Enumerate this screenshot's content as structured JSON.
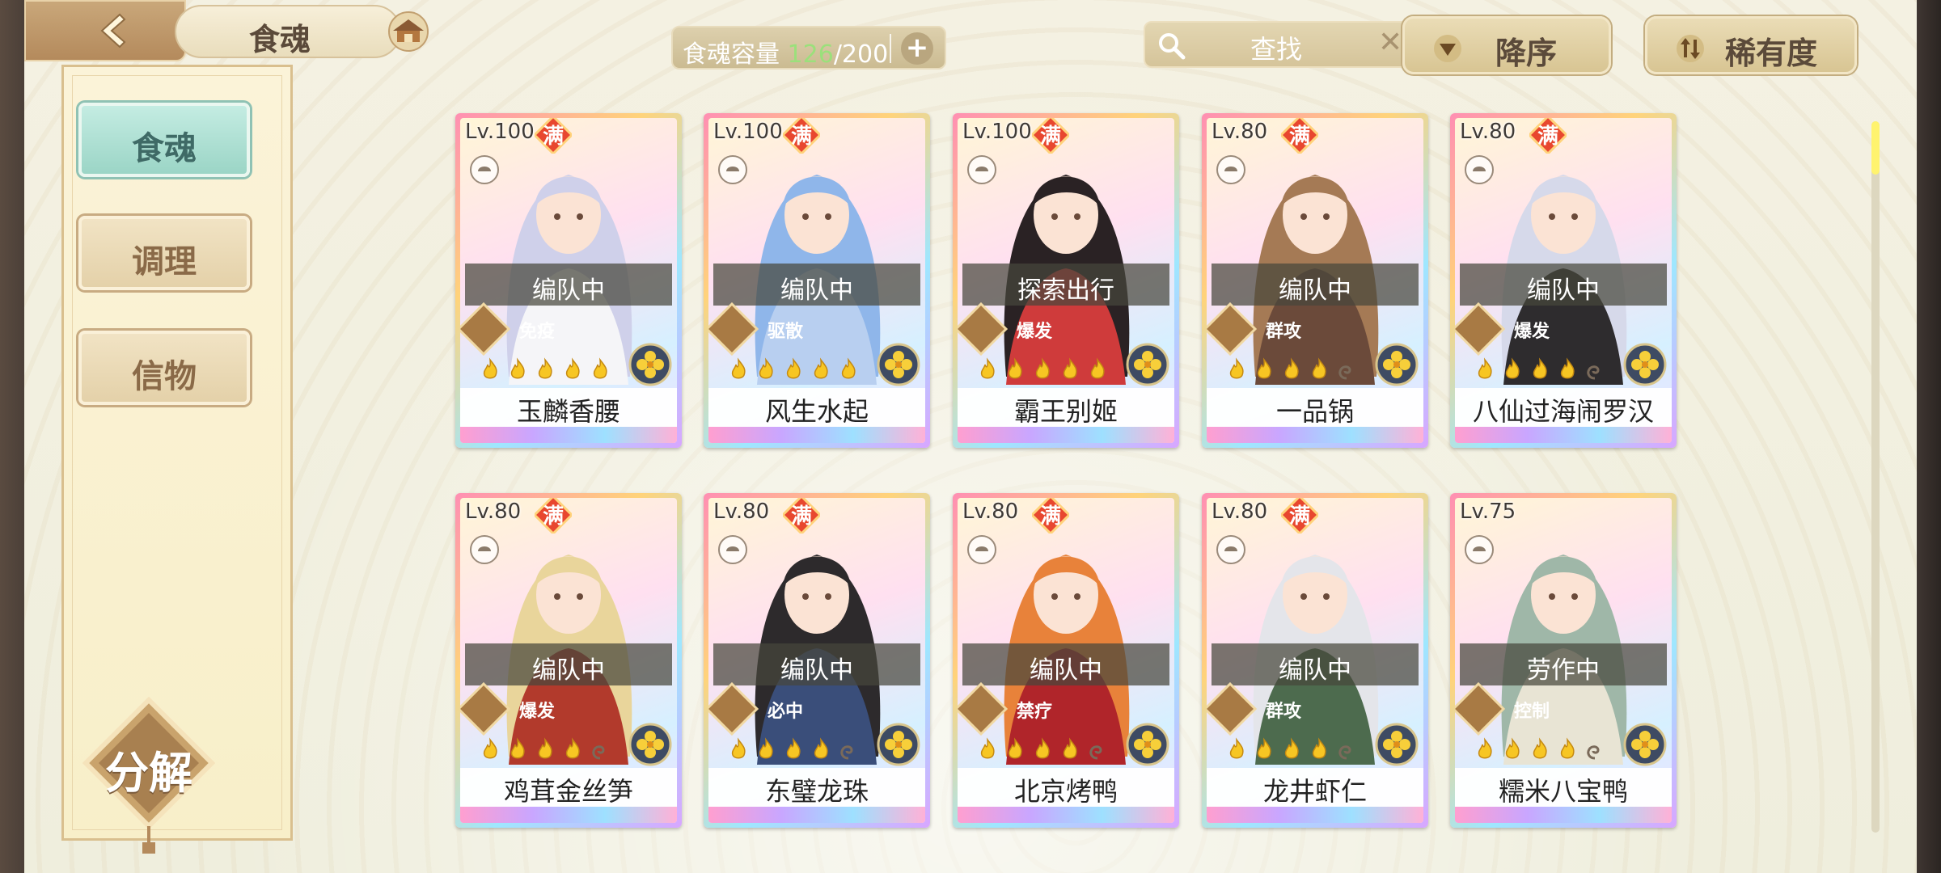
{
  "header": {
    "title": "食魂",
    "capacity_label": "食魂容量",
    "capacity_current": "126",
    "capacity_total": "/200",
    "capacity_add": "+",
    "search_placeholder": "查找",
    "search_clear": "✕",
    "sort_order_label": "降序",
    "sort_key_label": "稀有度"
  },
  "sidebar": {
    "items": [
      {
        "label": "食魂",
        "active": true
      },
      {
        "label": "调理",
        "active": false
      },
      {
        "label": "信物",
        "active": false
      }
    ],
    "decompose_label": "分解"
  },
  "colors": {
    "accent_active": "#9bd5c6",
    "capacity_current": "#9be07b",
    "full_badge": "#e8472f"
  },
  "cards": [
    {
      "level": "Lv.100",
      "full": true,
      "full_label": "满",
      "status": "编队中",
      "role": "免疫",
      "stars": 5,
      "name": "玉麟香腰"
    },
    {
      "level": "Lv.100",
      "full": true,
      "full_label": "满",
      "status": "编队中",
      "role": "驱散",
      "stars": 5,
      "name": "风生水起"
    },
    {
      "level": "Lv.100",
      "full": true,
      "full_label": "满",
      "status": "探索出行",
      "role": "爆发",
      "stars": 5,
      "name": "霸王别姬"
    },
    {
      "level": "Lv.80",
      "full": true,
      "full_label": "满",
      "status": "编队中",
      "role": "群攻",
      "stars": 4,
      "name": "一品锅"
    },
    {
      "level": "Lv.80",
      "full": true,
      "full_label": "满",
      "status": "编队中",
      "role": "爆发",
      "stars": 4,
      "name": "八仙过海闹罗汉"
    },
    {
      "level": "Lv.80",
      "full": true,
      "full_label": "满",
      "status": "编队中",
      "role": "爆发",
      "stars": 4,
      "name": "鸡茸金丝笋"
    },
    {
      "level": "Lv.80",
      "full": true,
      "full_label": "满",
      "status": "编队中",
      "role": "必中",
      "stars": 4,
      "name": "东璧龙珠"
    },
    {
      "level": "Lv.80",
      "full": true,
      "full_label": "满",
      "status": "编队中",
      "role": "禁疗",
      "stars": 4,
      "name": "北京烤鸭"
    },
    {
      "level": "Lv.80",
      "full": true,
      "full_label": "满",
      "status": "编队中",
      "role": "群攻",
      "stars": 4,
      "name": "龙井虾仁"
    },
    {
      "level": "Lv.75",
      "full": false,
      "full_label": "",
      "status": "劳作中",
      "role": "控制",
      "stars": 4,
      "name": "糯米八宝鸭"
    }
  ],
  "scroll_position": 0
}
